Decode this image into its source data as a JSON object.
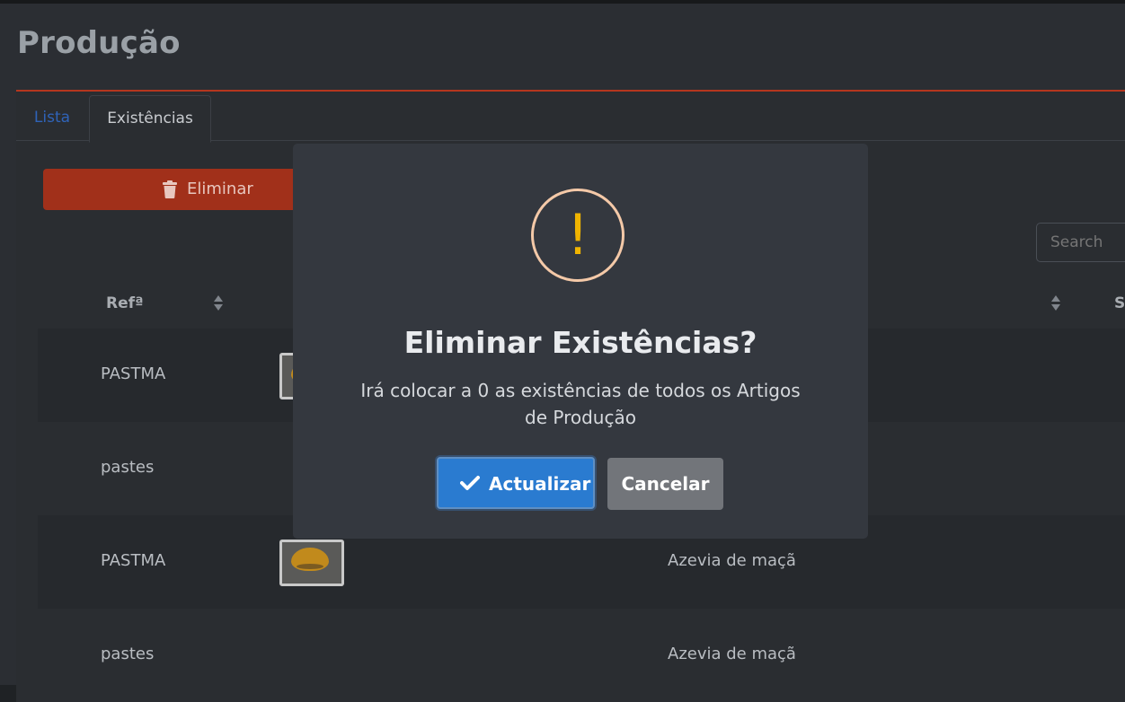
{
  "page": {
    "title": "Produção"
  },
  "tabs": [
    {
      "label": "Lista"
    },
    {
      "label": "Existências"
    }
  ],
  "toolbar": {
    "delete_label": "Eliminar"
  },
  "search": {
    "placeholder": "Search"
  },
  "table": {
    "headers": {
      "ref": "Refª",
      "s": "S"
    },
    "rows": [
      {
        "ref": "PASTMA",
        "desc": ""
      },
      {
        "ref": "pastes",
        "desc": ""
      },
      {
        "ref": "PASTMA",
        "desc": "Azevia de maçã"
      },
      {
        "ref": "pastes",
        "desc": "Azevia de maçã"
      }
    ]
  },
  "dialog": {
    "icon": "warning-icon",
    "title": "Eliminar Existências?",
    "text": "Irá colocar a 0 as existências de todos os Artigos de Produção",
    "confirm_label": "Actualizar",
    "cancel_label": "Cancelar"
  },
  "colors": {
    "accent_red": "#a1301a",
    "confirm_blue": "#2a7bd0",
    "warning_yellow": "#f0b400",
    "warning_ring": "#f4c9a8"
  }
}
